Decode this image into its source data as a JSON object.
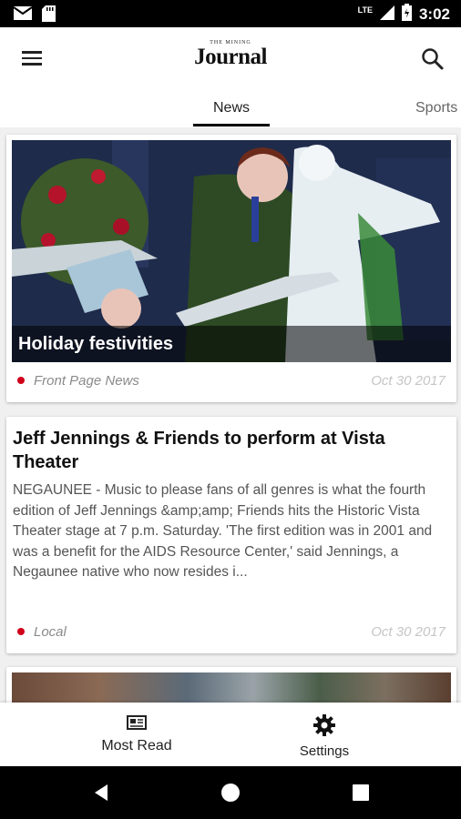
{
  "status_bar": {
    "network": "LTE",
    "time": "3:02",
    "icons": [
      "gmail-icon",
      "sd-card-icon",
      "signal-icon",
      "battery-icon"
    ]
  },
  "app_bar": {
    "logo_small": "THE MINING",
    "logo_big": "Journal",
    "icons": [
      "menu-icon",
      "search-icon"
    ]
  },
  "tabs": [
    {
      "label": "News",
      "selected": true
    },
    {
      "label": "Sports",
      "selected": false
    }
  ],
  "articles": [
    {
      "headline": "Holiday festivities",
      "category": "Front Page News",
      "date": "Oct 30 2017",
      "has_image": true
    },
    {
      "headline": "Jeff Jennings & Friends to perform at Vista Theater",
      "excerpt": "NEGAUNEE - Music to please fans of all genres is what the fourth edition of Jeff Jennings &amp;amp; Friends hits the Historic Vista Theater stage at 7 p.m. Saturday. 'The first edition was in 2001 and was a benefit for the AIDS Resource Center,' said Jennings, a Negaunee native who now resides i...",
      "category": "Local",
      "date": "Oct 30 2017"
    }
  ],
  "bottom_nav": [
    {
      "label": "Most Read",
      "icon": "newspaper-icon"
    },
    {
      "label": "Settings",
      "icon": "gear-icon"
    }
  ],
  "system_nav": [
    "back-icon",
    "home-icon",
    "recents-icon"
  ],
  "colors": {
    "accent": "#d0021b",
    "status_bar": "#000000",
    "tab_indicator": "#000000"
  }
}
